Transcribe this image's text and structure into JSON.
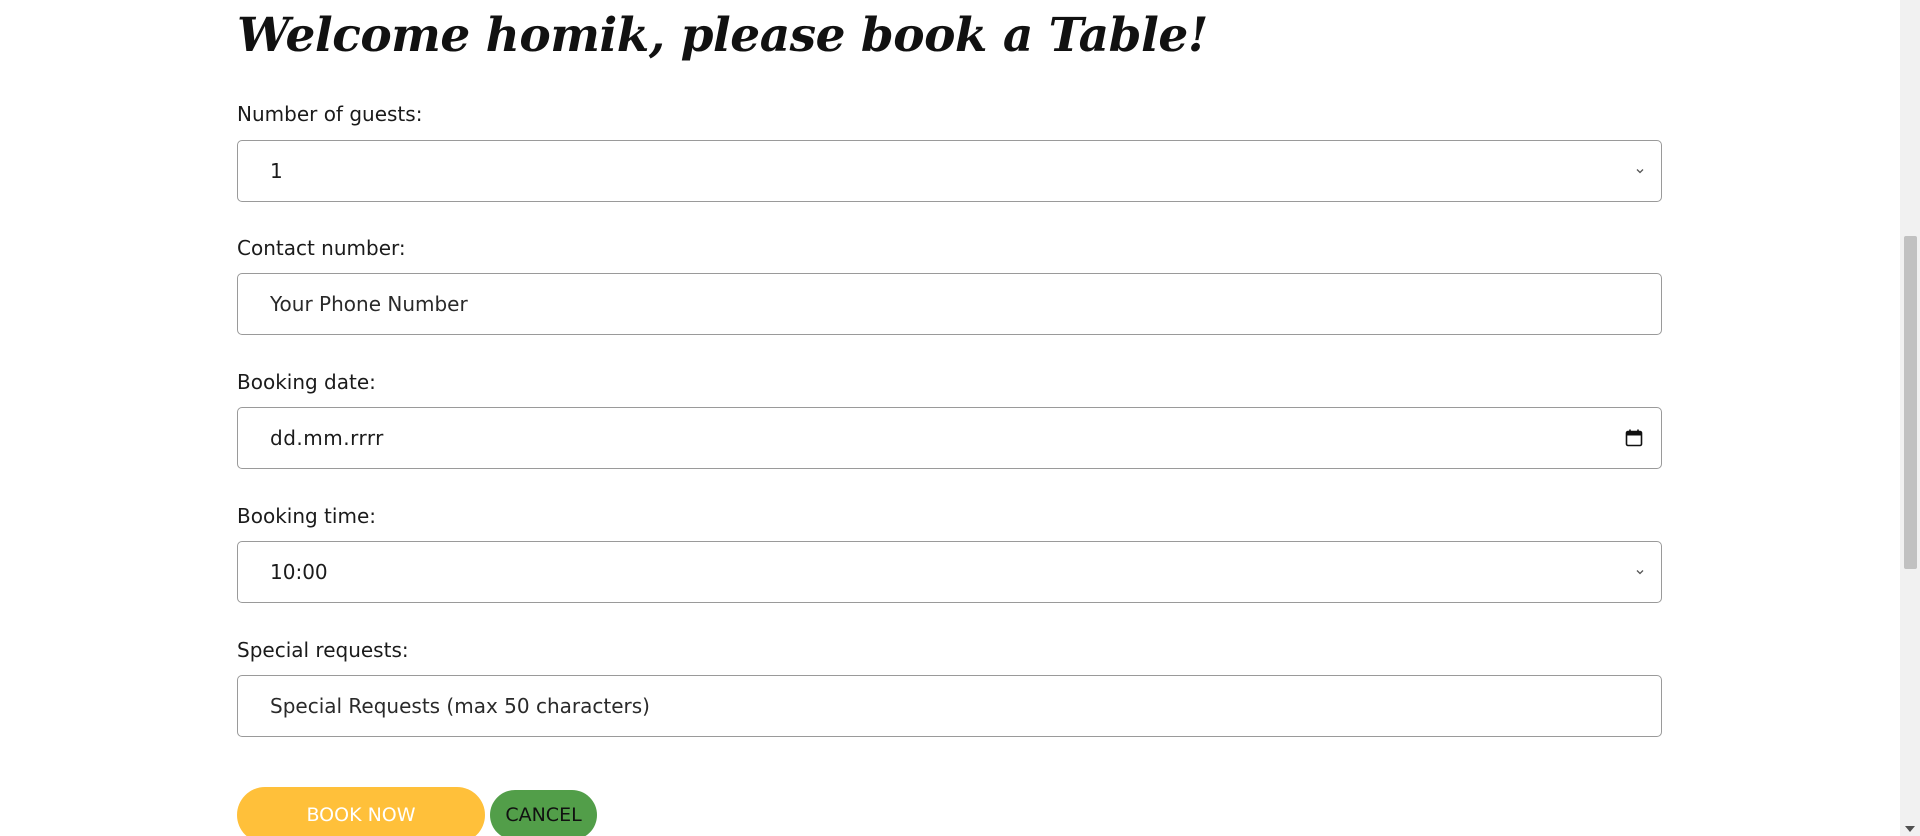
{
  "heading": "Welcome homik, please book a Table!",
  "form": {
    "guests": {
      "label": "Number of guests:",
      "value": "1",
      "icon": "chevron-down-icon"
    },
    "contact": {
      "label": "Contact number:",
      "placeholder": "Your Phone Number"
    },
    "date": {
      "label": "Booking date:",
      "placeholder": "dd.mm.rrrr",
      "icon": "calendar-icon"
    },
    "time": {
      "label": "Booking time:",
      "value": "10:00",
      "icon": "chevron-down-icon"
    },
    "requests": {
      "label": "Special requests:",
      "placeholder": "Special Requests (max 50 characters)"
    }
  },
  "buttons": {
    "book": "BOOK NOW",
    "cancel": "CANCEL"
  },
  "colors": {
    "book_button": "#ffc03a",
    "cancel_button": "#529e49",
    "border": "#9a9a9a"
  }
}
